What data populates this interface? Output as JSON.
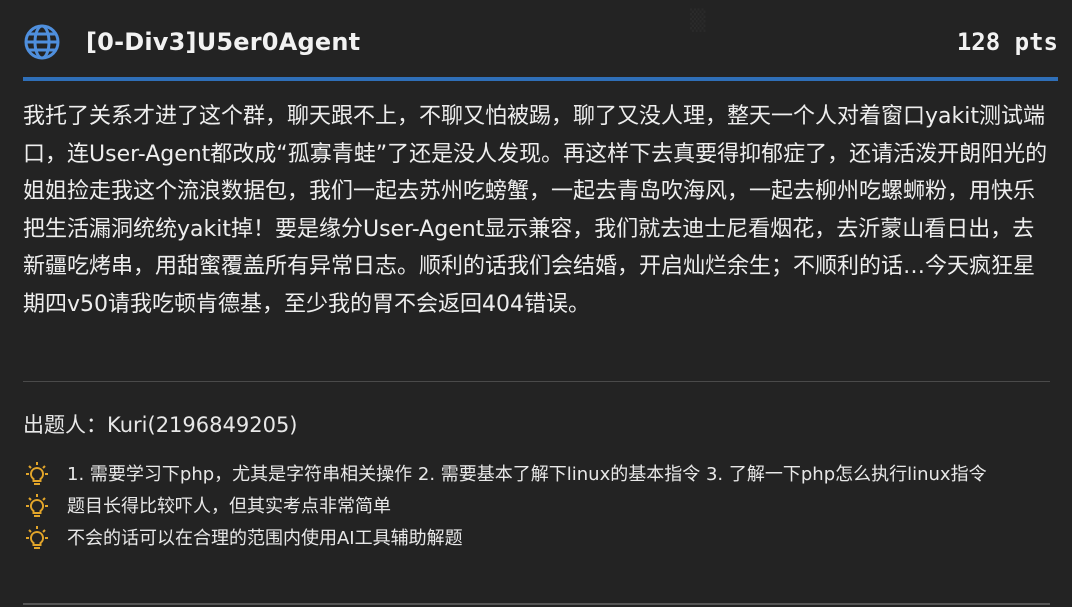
{
  "challenge": {
    "title": "[0-Div3]U5er0Agent",
    "points": "128 pts",
    "description": "我托了关系才进了这个群，聊天跟不上，不聊又怕被踢，聊了又没人理，整天一个人对着窗口yakit测试端口，连User-Agent都改成“孤寡青蛙”了还是没人发现。再这样下去真要得抑郁症了，还请活泼开朗阳光的姐姐捡走我这个流浪数据包，我们一起去苏州吃螃蟹，一起去青岛吹海风，一起去柳州吃螺蛳粉，用快乐把生活漏洞统统yakit掉！要是缘分User-Agent显示兼容，我们就去迪士尼看烟花，去沂蒙山看日出，去新疆吃烤串，用甜蜜覆盖所有异常日志。顺利的话我们会结婚，开启灿烂余生；不顺利的话…今天疯狂星期四v50请我吃顿肯德基，至少我的胃不会返回404错误。",
    "author": "出题人：Kuri(2196849205)",
    "hints": [
      "1. 需要学习下php，尤其是字符串相关操作 2. 需要基本了解下linux的基本指令 3. 了解一下php怎么执行linux指令",
      "题目长得比较吓人，但其实考点非常简单",
      "不会的话可以在合理的范围内使用AI工具辅助解题"
    ]
  },
  "icons": {
    "header": "globe-icon",
    "hint": "lightbulb-icon"
  },
  "colors": {
    "background": "#232323",
    "accent": "#2f6fb8",
    "bulb": "#e2a52a"
  }
}
